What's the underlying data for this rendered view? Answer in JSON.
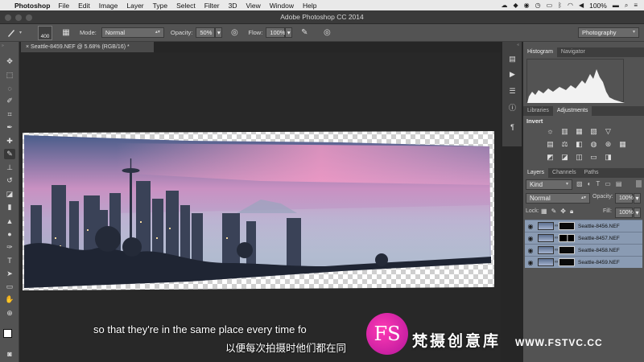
{
  "menubar": {
    "app": "Photoshop",
    "items": [
      "File",
      "Edit",
      "Image",
      "Layer",
      "Type",
      "Select",
      "Filter",
      "3D",
      "View",
      "Window",
      "Help"
    ],
    "battery": "100%"
  },
  "window": {
    "title": "Adobe Photoshop CC 2014"
  },
  "options": {
    "brush_size": "400",
    "mode_label": "Mode:",
    "mode_value": "Normal",
    "opacity_label": "Opacity:",
    "opacity_value": "50%",
    "flow_label": "Flow:",
    "flow_value": "100%",
    "workspace": "Photography"
  },
  "document": {
    "tab": "Seattle-8459.NEF @ 5.68% (RGB/16) *"
  },
  "panels": {
    "histogram_tab": "Histogram",
    "navigator_tab": "Navigator",
    "libraries_tab": "Libraries",
    "adjustments_tab": "Adjustments",
    "adjustment_name": "Invert",
    "layers_tab": "Layers",
    "channels_tab": "Channels",
    "paths_tab": "Paths",
    "kind": "Kind",
    "blend_mode": "Normal",
    "opacity_label": "Opacity:",
    "opacity_value": "100%",
    "lock_label": "Lock:",
    "fill_label": "Fill:",
    "fill_value": "100%",
    "layers": [
      {
        "name": "Seattle-8456.NEF"
      },
      {
        "name": "Seattle-8457.NEF"
      },
      {
        "name": "Seattle-8458.NEF"
      },
      {
        "name": "Seattle-8459.NEF"
      }
    ]
  },
  "subtitles": {
    "english": "so that they're in the same place every time fo",
    "chinese": "以便每次拍摄时他们都在同"
  },
  "watermark": {
    "logo": "FS",
    "name": "梵摄创意库",
    "url": "WWW.FSTVC.CC"
  },
  "colors": {
    "accent": "#8a9bb3",
    "ui_dark": "#535353",
    "brand": "#d81ea8"
  }
}
